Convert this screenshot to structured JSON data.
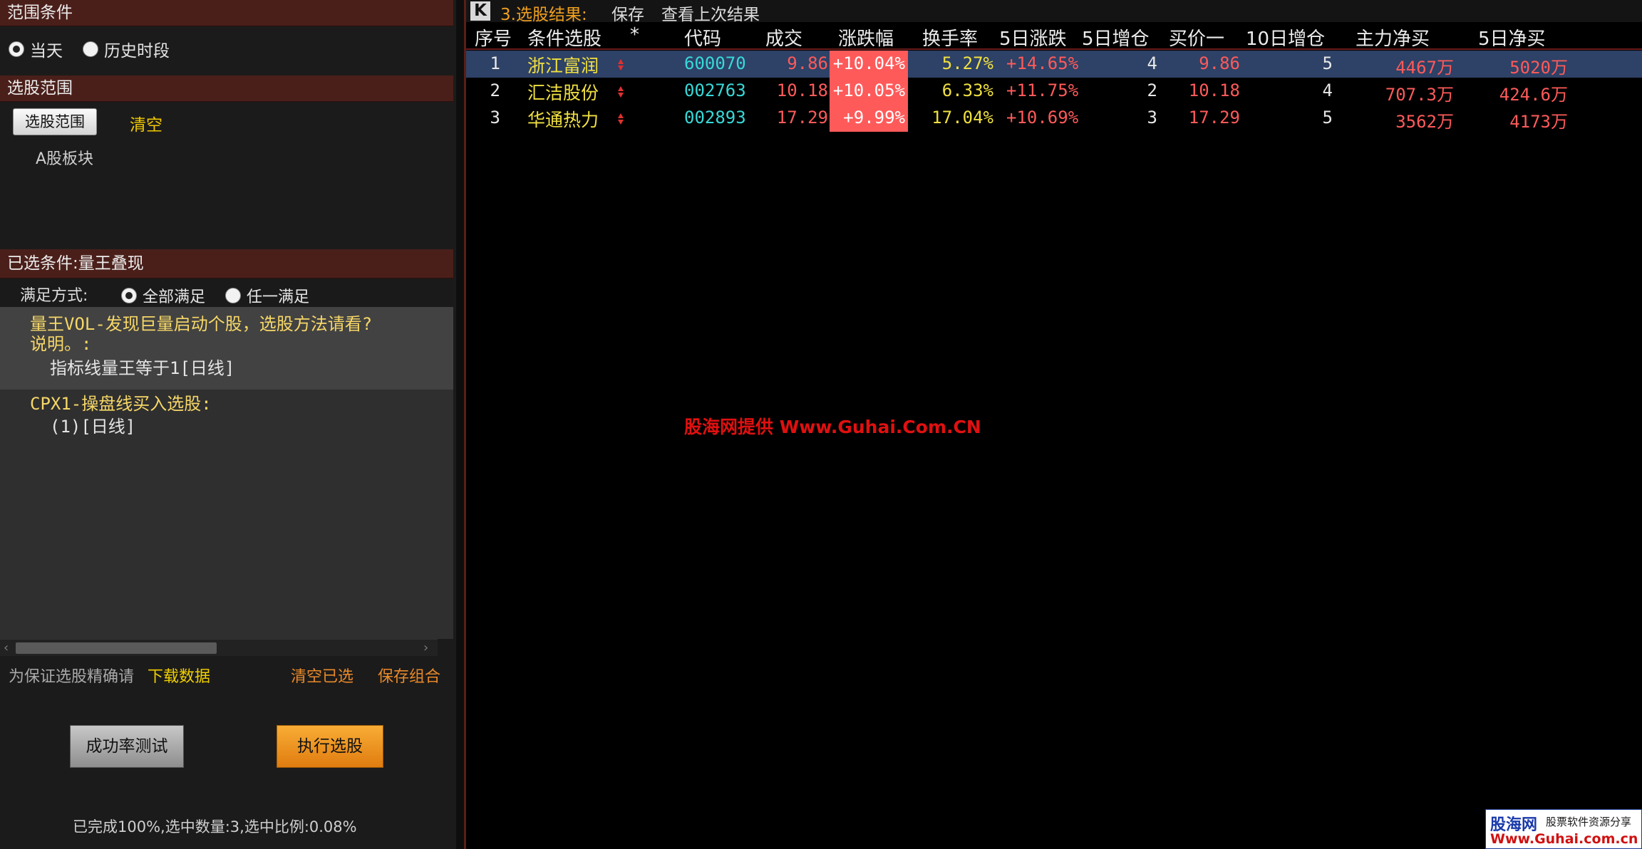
{
  "left": {
    "scope_header": "范围条件",
    "scope_options": [
      "当天",
      "历史时段"
    ],
    "range_header": "选股范围",
    "range_button": "选股范围",
    "clear_label": "清空",
    "range_value": "A股板块",
    "selected_header": "已选条件:量王叠现",
    "mode_label": "满足方式:",
    "mode_options": [
      "全部满足",
      "任一满足"
    ],
    "conditions": [
      {
        "title_line1": "量王VOL-发现巨量启动个股，选股方法请看?",
        "title_line2": "说明。:",
        "detail": "指标线量王等于1[日线]"
      },
      {
        "title_line1": "CPX1-操盘线买入选股:",
        "detail": "(1)[日线]"
      }
    ],
    "hint": "为保证选股精确请",
    "download_link": "下载数据",
    "clear_selected": "清空已选",
    "save_combo": "保存组合",
    "test_button": "成功率测试",
    "exec_button": "执行选股",
    "status": "已完成100%,选中数量:3,选中比例:0.08%"
  },
  "right": {
    "logo_letter": "K",
    "title": "3.选股结果:",
    "save_label": "保存",
    "view_last_label": "查看上次结果",
    "columns": [
      "序号",
      "条件选股",
      "*",
      "代码",
      "成交",
      "涨跌幅",
      "换手率",
      "5日涨跌",
      "5日增仓",
      "买价一",
      "10日增仓",
      "主力净买",
      "5日净买"
    ],
    "rows": [
      {
        "idx": "1",
        "name": "浙江富润",
        "code": "600070",
        "price": "9.86",
        "change": "+10.04%",
        "turnover": "5.27%",
        "chg5": "+14.65%",
        "inc5": "4",
        "bid1": "9.86",
        "inc10": "5",
        "main_net": "4467万",
        "net5": "5020万"
      },
      {
        "idx": "2",
        "name": "汇洁股份",
        "code": "002763",
        "price": "10.18",
        "change": "+10.05%",
        "turnover": "6.33%",
        "chg5": "+11.75%",
        "inc5": "2",
        "bid1": "10.18",
        "inc10": "4",
        "main_net": "707.3万",
        "net5": "424.6万"
      },
      {
        "idx": "3",
        "name": "华通热力",
        "code": "002893",
        "price": "17.29",
        "change": "+9.99%",
        "turnover": "17.04%",
        "chg5": "+10.69%",
        "inc5": "3",
        "bid1": "17.29",
        "inc10": "5",
        "main_net": "3562万",
        "net5": "4173万"
      }
    ],
    "watermark": "股海网提供 Www.Guhai.Com.CN",
    "corner_logo_a": "股海网",
    "corner_logo_b": "股票软件资源分享",
    "corner_logo_url": "Www.Guhai.com.cn"
  },
  "colors": {
    "header_bg": "#4a1f1a",
    "gain_red": "#ff5a5a",
    "code_cyan": "#38d8d8",
    "stock_yellow": "#f0e040",
    "accent_orange": "#f0a020"
  }
}
